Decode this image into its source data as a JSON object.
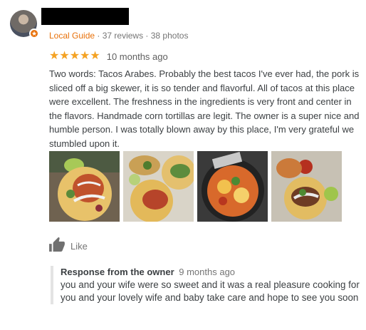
{
  "reviewer": {
    "badge_icon": "star-badge-icon",
    "local_guide": "Local Guide",
    "sep1": " · ",
    "reviews": "37 reviews",
    "sep2": " · ",
    "photos": "38 photos"
  },
  "rating": {
    "stars": "★★★★★",
    "value": 5,
    "max": 5,
    "age": "10 months ago"
  },
  "review_text": "Two words: Tacos Arabes. Probably the best tacos I've ever had, the pork is sliced off a big skewer, it is so tender and flavorful. All of tacos at this place were excellent. The freshness in the ingredients is very front and center in the flavors. Handmade corn tortillas are legit. The owner is a super nice and humble person. I was totally blown away by this place, I'm very grateful we stumbled upon it.",
  "photos_count_shown": 4,
  "like": {
    "icon": "thumbs-up-icon",
    "label": "Like"
  },
  "owner_response": {
    "title": "Response from the owner",
    "age": "9 months ago",
    "text": "you and your wife were so sweet and it was a real pleasure cooking for you and your lovely wife and baby take care and hope to see you soon"
  },
  "colors": {
    "accent": "#e8710a",
    "stars": "#f4a223",
    "muted": "#757575"
  }
}
